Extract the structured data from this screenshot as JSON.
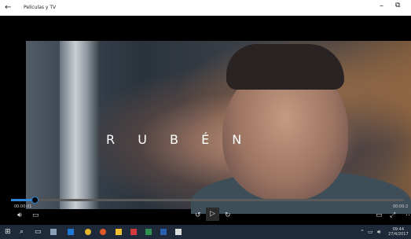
{
  "titlebar": {
    "back_icon": "back-arrow",
    "title": "Películas y TV",
    "minimize": "–",
    "restore": "⧉"
  },
  "video": {
    "overlay_text": "R U B É N"
  },
  "player": {
    "current_time": "00:00:01",
    "end_time": "00:00:2",
    "progress_fraction": 0.06,
    "volume_icon": "speaker-icon",
    "subtitles_icon": "subtitles-icon",
    "back_icon": "skip-back-icon",
    "play_icon": "play-icon",
    "forward_icon": "skip-forward-icon",
    "cast_icon": "cast-icon",
    "fullscreen_icon": "fullscreen-icon"
  },
  "taskbar": {
    "apps": [
      "windows-logo",
      "search-icon",
      "task-view",
      "file-explorer",
      "edge",
      "chrome",
      "chrome-alt",
      "file-manager",
      "word",
      "excel",
      "photos",
      "movies-tv"
    ],
    "tray_time": "09:44",
    "tray_date": "27/4/2017",
    "accent": "#2f86d8"
  }
}
